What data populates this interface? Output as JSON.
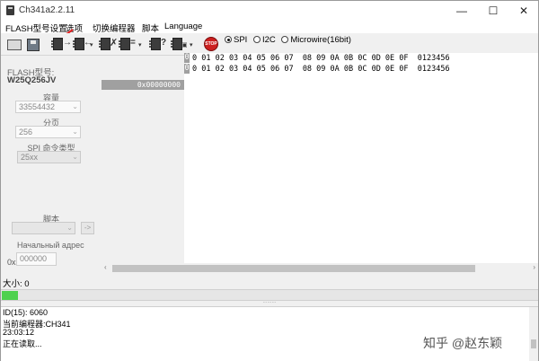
{
  "window": {
    "title": "Ch341a2.2.11",
    "controls": {
      "minimize": "—",
      "maximize": "☐",
      "close": "✕"
    }
  },
  "menu": [
    "FLASH型号设置",
    "选项",
    "切换编程器",
    "脚本",
    "Language"
  ],
  "toolbar": {
    "icons": [
      "open-file-icon",
      "save-file-icon",
      "read-chip-icon",
      "write-chip-icon",
      "erase-chip-icon",
      "verify-chip-icon",
      "detect-chip-icon",
      "auto-icon",
      "stop-icon"
    ],
    "stop_label": "STOP",
    "dropdown_glyph": "▾",
    "protocols": [
      {
        "label": "SPI",
        "checked": true
      },
      {
        "label": "I2C",
        "checked": false
      },
      {
        "label": "Microwire(16bit)",
        "checked": false
      }
    ]
  },
  "left_panel": {
    "flash_model_label": "FLASH型号:",
    "flash_model_value": "W25Q256JV",
    "capacity_label": "容量",
    "capacity_value": "33554432",
    "page_label": "分页",
    "page_value": "256",
    "spi_cmd_label": "SPI 命令类型",
    "spi_cmd_value": "25xx",
    "script_label": "脚本",
    "script_button": "->",
    "start_addr_label": "Начальный адрес",
    "addr_prefix": "0x",
    "addr_value": "000000"
  },
  "hex_view": {
    "header1": "0 01 02 03 04 05 06 07  08 09 0A 0B 0C 0D 0E 0F  0123456",
    "header2": "0 01 02 03 04 05 06 07  08 09 0A 0B 0C 0D 0E 0F  0123456",
    "mark_label": "0",
    "selected_address": "0x00000000"
  },
  "status": {
    "size_label": "大小: 0",
    "progress": 0.03
  },
  "log": {
    "lines": [
      "ID(15): 6060",
      "当前编程器:CH341",
      "23:03:12",
      "正在读取..."
    ]
  },
  "watermark": "知乎 @赵东颖",
  "colors": {
    "progress_fill": "#4fd14f",
    "stop_red": "#cc1f1f",
    "annotation_arrow": "#e02020"
  }
}
